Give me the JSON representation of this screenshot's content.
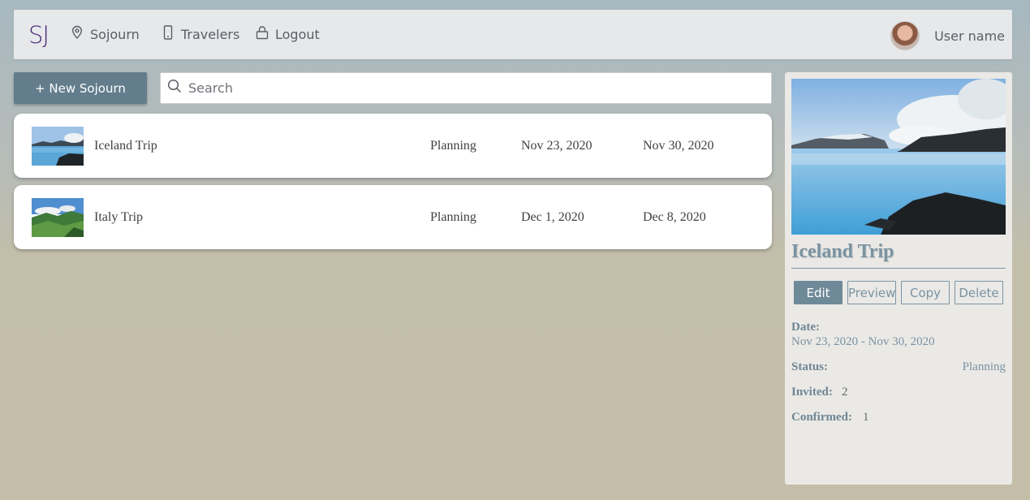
{
  "nav": {
    "brand": "SJ",
    "items": [
      {
        "label": "Sojourn",
        "icon": "map-pin-icon"
      },
      {
        "label": "Travelers",
        "icon": "phone-icon"
      },
      {
        "label": "Logout",
        "icon": "lock-icon"
      }
    ],
    "user_name": "User name"
  },
  "toolbar": {
    "new_label": "+ New Sojourn",
    "search_placeholder": "Search"
  },
  "trips": [
    {
      "name": "Iceland Trip",
      "status": "Planning",
      "start": "Nov 23, 2020",
      "end": "Nov 30, 2020"
    },
    {
      "name": "Italy Trip",
      "status": "Planning",
      "start": "Dec 1, 2020",
      "end": "Dec 8, 2020"
    }
  ],
  "detail": {
    "title": "Iceland Trip",
    "actions": {
      "edit": "Edit",
      "preview": "Preview",
      "copy": "Copy",
      "delete": "Delete"
    },
    "date_label": "Date:",
    "date_value": "Nov 23, 2020 - Nov 30, 2020",
    "status_label": "Status:",
    "status_value": "Planning",
    "invited_label": "Invited:",
    "invited_value": "2",
    "confirmed_label": "Confirmed:",
    "confirmed_value": "1"
  },
  "colors": {
    "brand": "#4b2a7b",
    "accent": "#637d8c",
    "panel_text": "#7a93a2"
  }
}
